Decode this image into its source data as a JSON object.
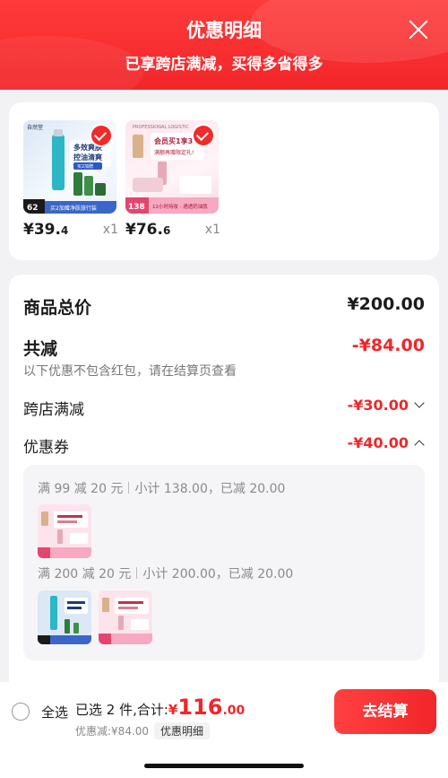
{
  "header": {
    "title": "优惠明细",
    "subtitle": "已享跨店满减，买得多省得多"
  },
  "products": [
    {
      "price_int": "¥39.",
      "price_dec": "4",
      "qty": "x1",
      "art": {
        "brand": "自然堂",
        "badge": "多效爽肤",
        "badge2": "控油清爽",
        "tag": "买2加赠",
        "foot": "买2加赠净肤旅行装",
        "num": "62"
      }
    },
    {
      "price_int": "¥76.",
      "price_dec": "6",
      "qty": "x1",
      "art": {
        "brand": "PROFESSIONAL LOGISTIC",
        "badge": "会员买1享3",
        "badge2": "满额再赠限定礼!",
        "num": "138",
        "foot": "12小时持妆 · 遇透奶油肌"
      }
    }
  ],
  "summary": {
    "total_label": "商品总价",
    "total_value": "¥200.00",
    "reduce_label": "共减",
    "reduce_value": "-¥84.00",
    "reduce_note": "以下优惠不包含红包，请在结算页查看",
    "cross_label": "跨店满减",
    "cross_value": "-¥30.00",
    "coupon_label": "优惠券",
    "coupon_value": "-¥40.00"
  },
  "coupon_groups": [
    {
      "rule": "满 99 减 20 元",
      "detail": "小计 138.00，已减 20.00"
    },
    {
      "rule": "满 200 减 20 元",
      "detail": "小计 200.00，已减 20.00"
    }
  ],
  "bottom": {
    "select_all": "全选",
    "selected_text": "已选 2 件,合计:",
    "currency": "¥",
    "total_int": "116",
    "total_dec": ".00",
    "discount_text": "优惠减:¥84.00",
    "detail_tag": "优惠明细",
    "checkout_label": "去结算"
  },
  "colors": {
    "accent": "#f0262a",
    "header_top": "#ff3a3a",
    "page_bg": "#f2f2f4"
  },
  "icons": [
    "close-icon",
    "check-icon",
    "chevron-down-icon",
    "chevron-up-icon",
    "radio-icon"
  ]
}
